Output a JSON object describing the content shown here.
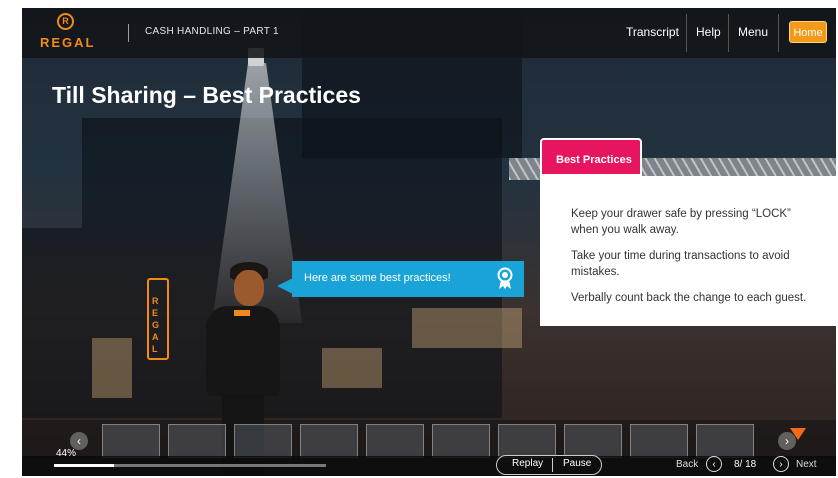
{
  "header": {
    "logo_text": "REGAL",
    "logo_mark": "R",
    "course_title": "CASH HANDLING – PART 1",
    "transcript": "Transcript",
    "help": "Help",
    "menu": "Menu",
    "home": "Home"
  },
  "slide": {
    "title": "Till Sharing – Best Practices",
    "sign_letters": [
      "R",
      "E",
      "G",
      "A",
      "L"
    ],
    "speech_bubble": "Here are some best practices!",
    "panel": {
      "tab_label": "Best Practices",
      "items": [
        "Keep your drawer safe by pressing “LOCK” when you walk away.",
        "Take your time during transactions to avoid mistakes.",
        "Verbally count back the change to each guest."
      ]
    }
  },
  "player": {
    "progress_percent": 44,
    "progress_label": "44%",
    "replay": "Replay",
    "pause": "Pause",
    "back": "Back",
    "slide_counter": "8/ 18",
    "next": "Next"
  },
  "colors": {
    "brand_orange": "#f08a1a",
    "tab_pink": "#e7155f",
    "bubble_blue": "#1aa3d6"
  }
}
